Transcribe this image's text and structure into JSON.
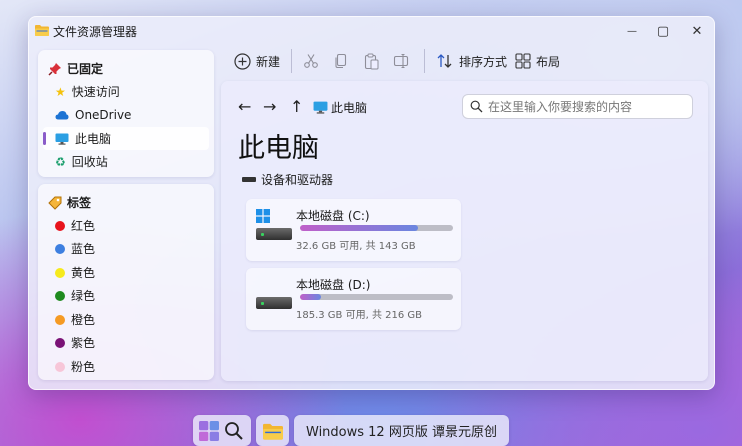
{
  "window": {
    "title": "文件资源管理器",
    "controls": {
      "minimize": "—",
      "maximize": "▢",
      "close": "✕"
    }
  },
  "sidebar": {
    "pinned": {
      "heading": "已固定",
      "items": [
        {
          "label": "快速访问",
          "icon": "star-icon"
        },
        {
          "label": "OneDrive",
          "icon": "cloud-icon"
        },
        {
          "label": "此电脑",
          "icon": "monitor-icon",
          "active": true
        },
        {
          "label": "回收站",
          "icon": "recycle-bin-icon"
        }
      ]
    },
    "tags": {
      "heading": "标签",
      "items": [
        {
          "label": "红色",
          "color": "#e8131c"
        },
        {
          "label": "蓝色",
          "color": "#3d7fe0"
        },
        {
          "label": "黄色",
          "color": "#f6ea1c"
        },
        {
          "label": "绿色",
          "color": "#1f8a1f"
        },
        {
          "label": "橙色",
          "color": "#f59a23"
        },
        {
          "label": "紫色",
          "color": "#7a1276"
        },
        {
          "label": "粉色",
          "color": "#f7c6d8"
        }
      ]
    }
  },
  "toolbar": {
    "new_label": "新建",
    "sort_label": "排序方式",
    "layout_label": "布局"
  },
  "content": {
    "breadcrumb": "此电脑",
    "search_placeholder": "在这里输入你要搜索的内容",
    "page_title": "此电脑",
    "section_title": "设备和驱动器",
    "drives": [
      {
        "name": "本地磁盘 (C:)",
        "info": "32.6 GB 可用, 共 143 GB",
        "used_fraction": 0.77
      },
      {
        "name": "本地磁盘 (D:)",
        "info": "185.3 GB 可用, 共 216 GB",
        "used_fraction": 0.14
      }
    ]
  },
  "taskbar": {
    "app_label": "Windows 12 网页版 谭景元原创"
  },
  "colors": {
    "accent": "#8a5cc9",
    "bar_start": "#c05fc9",
    "bar_end": "#6a86e0"
  }
}
